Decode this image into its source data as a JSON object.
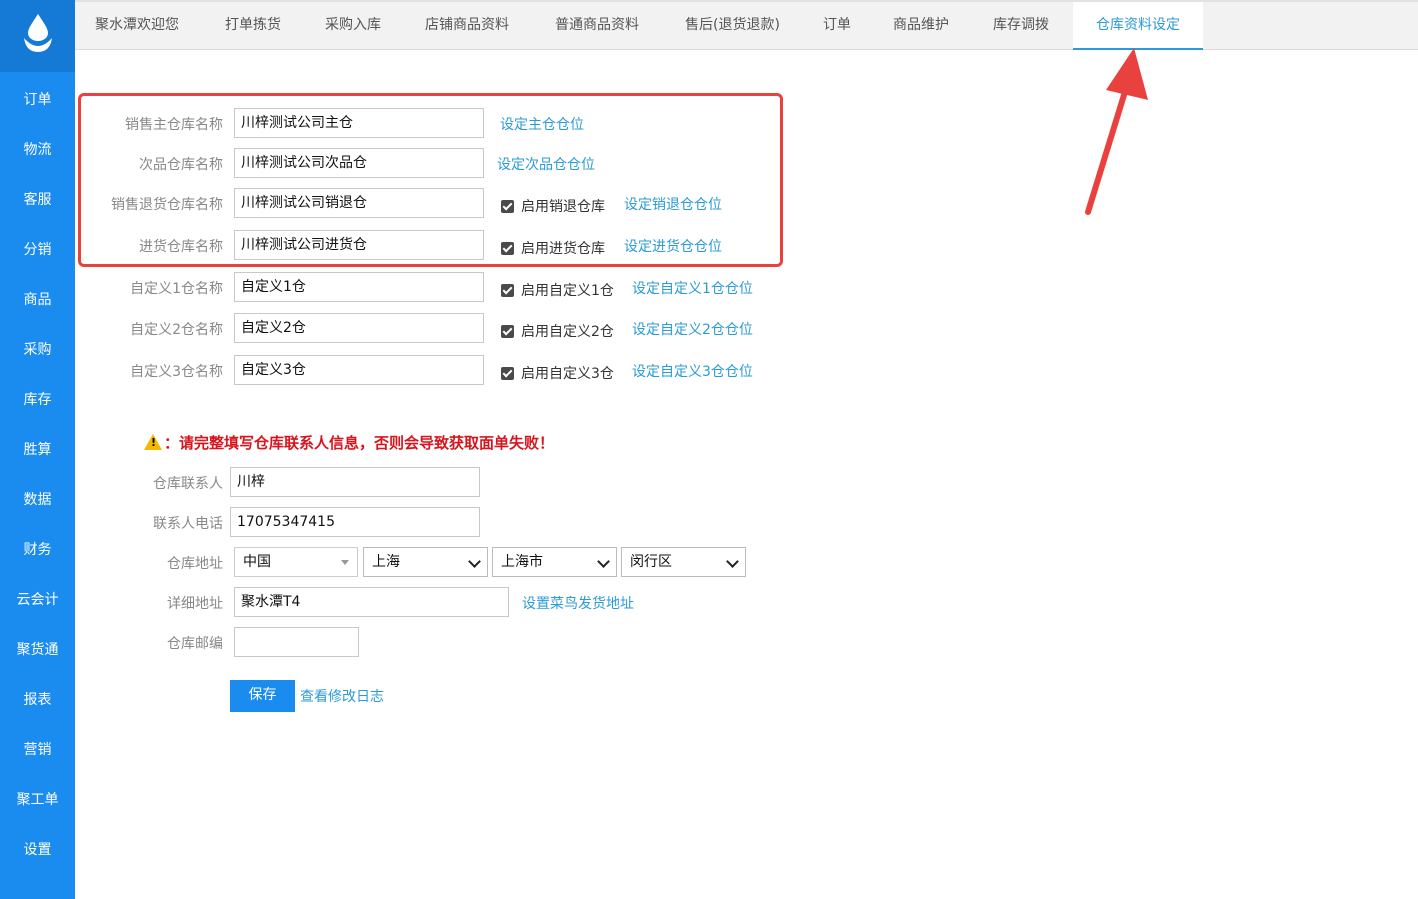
{
  "sidebar": {
    "items": [
      {
        "label": "订单"
      },
      {
        "label": "物流"
      },
      {
        "label": "客服"
      },
      {
        "label": "分销"
      },
      {
        "label": "商品"
      },
      {
        "label": "采购"
      },
      {
        "label": "库存"
      },
      {
        "label": "胜算"
      },
      {
        "label": "数据"
      },
      {
        "label": "财务"
      },
      {
        "label": "云会计"
      },
      {
        "label": "聚货通"
      },
      {
        "label": "报表"
      },
      {
        "label": "营销"
      },
      {
        "label": "聚工单"
      },
      {
        "label": "设置"
      }
    ]
  },
  "tabs": [
    {
      "label": "聚水潭欢迎您"
    },
    {
      "label": "打单拣货"
    },
    {
      "label": "采购入库"
    },
    {
      "label": "店铺商品资料"
    },
    {
      "label": "普通商品资料"
    },
    {
      "label": "售后(退货退款)"
    },
    {
      "label": "订单"
    },
    {
      "label": "商品维护"
    },
    {
      "label": "库存调拨"
    },
    {
      "label": "仓库资料设定"
    }
  ],
  "warehouses": {
    "main": {
      "label": "销售主仓库名称",
      "value": "川梓测试公司主仓",
      "link": "设定主仓仓位"
    },
    "defect": {
      "label": "次品仓库名称",
      "value": "川梓测试公司次品仓",
      "link": "设定次品仓仓位"
    },
    "return": {
      "label": "销售退货仓库名称",
      "value": "川梓测试公司销退仓",
      "checkbox": "启用销退仓库",
      "link": "设定销退仓仓位"
    },
    "purchase": {
      "label": "进货仓库名称",
      "value": "川梓测试公司进货仓",
      "checkbox": "启用进货仓库",
      "link": "设定进货仓仓位"
    },
    "custom1": {
      "label": "自定义1仓名称",
      "value": "自定义1仓",
      "checkbox": "启用自定义1仓",
      "link": "设定自定义1仓仓位"
    },
    "custom2": {
      "label": "自定义2仓名称",
      "value": "自定义2仓",
      "checkbox": "启用自定义2仓",
      "link": "设定自定义2仓仓位"
    },
    "custom3": {
      "label": "自定义3仓名称",
      "value": "自定义3仓",
      "checkbox": "启用自定义3仓",
      "link": "设定自定义3仓仓位"
    }
  },
  "warning": "：请完整填写仓库联系人信息，否则会导致获取面单失败！",
  "contact": {
    "name_label": "仓库联系人",
    "name_value": "川梓",
    "phone_label": "联系人电话",
    "phone_value": "17075347415",
    "address_label": "仓库地址",
    "country": "中国",
    "province": "上海",
    "city": "上海市",
    "district": "闵行区",
    "detail_label": "详细地址",
    "detail_value": "聚水潭T4",
    "cainiao_link": "设置菜鸟发货地址",
    "zip_label": "仓库邮编",
    "zip_value": ""
  },
  "actions": {
    "save": "保存",
    "log": "查看修改日志"
  },
  "colors": {
    "sidebar": "#1a8cf0",
    "accent": "#2b9bd6",
    "highlight": "#e8413e",
    "warning": "#d9141c"
  }
}
